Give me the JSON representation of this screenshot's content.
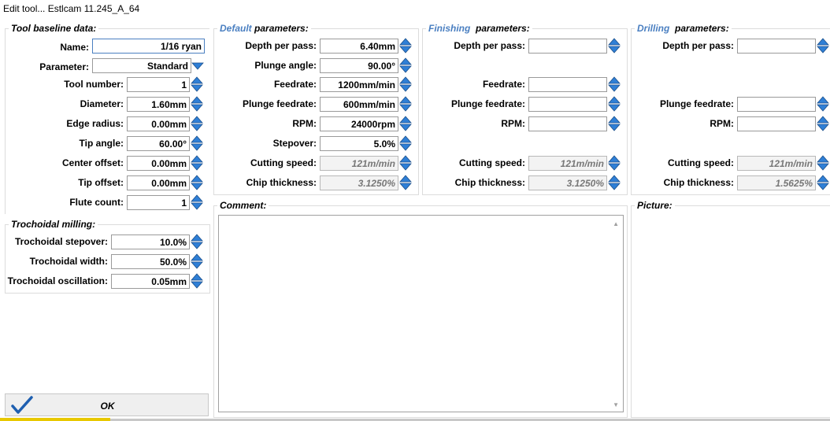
{
  "window": {
    "title": "Edit tool... Estlcam 11.245_A_64"
  },
  "baseline": {
    "title": "Tool baseline data:",
    "name_label": "Name:",
    "name_value": "1/16 ryan",
    "parameter_label": "Parameter:",
    "parameter_value": "Standard",
    "tool_number_label": "Tool number:",
    "tool_number_value": "1",
    "diameter_label": "Diameter:",
    "diameter_value": "1.60mm",
    "edge_radius_label": "Edge radius:",
    "edge_radius_value": "0.00mm",
    "tip_angle_label": "Tip angle:",
    "tip_angle_value": "60.00°",
    "center_offset_label": "Center offset:",
    "center_offset_value": "0.00mm",
    "tip_offset_label": "Tip offset:",
    "tip_offset_value": "0.00mm",
    "flute_count_label": "Flute count:",
    "flute_count_value": "1"
  },
  "trochoidal": {
    "title": "Trochoidal  milling:",
    "stepover_label": "Trochoidal stepover:",
    "stepover_value": "10.0%",
    "width_label": "Trochoidal width:",
    "width_value": "50.0%",
    "oscillation_label": "Trochoidal oscillation:",
    "oscillation_value": "0.05mm"
  },
  "default_params": {
    "title_hl": "Default",
    "title_rest": "parameters:",
    "depth_label": "Depth per pass:",
    "depth_value": "6.40mm",
    "plunge_angle_label": "Plunge angle:",
    "plunge_angle_value": "90.00°",
    "feedrate_label": "Feedrate:",
    "feedrate_value": "1200mm/min",
    "plunge_feedrate_label": "Plunge feedrate:",
    "plunge_feedrate_value": "600mm/min",
    "rpm_label": "RPM:",
    "rpm_value": "24000rpm",
    "stepover_label": "Stepover:",
    "stepover_value": "5.0%",
    "cutting_speed_label": "Cutting speed:",
    "cutting_speed_value": "121m/min",
    "chip_thickness_label": "Chip thickness:",
    "chip_thickness_value": "3.1250%"
  },
  "finishing_params": {
    "title_hl": "Finishing",
    "title_rest": "parameters:",
    "depth_label": "Depth per pass:",
    "depth_value": "",
    "feedrate_label": "Feedrate:",
    "feedrate_value": "",
    "plunge_feedrate_label": "Plunge feedrate:",
    "plunge_feedrate_value": "",
    "rpm_label": "RPM:",
    "rpm_value": "",
    "cutting_speed_label": "Cutting speed:",
    "cutting_speed_value": "121m/min",
    "chip_thickness_label": "Chip thickness:",
    "chip_thickness_value": "3.1250%"
  },
  "drilling_params": {
    "title_hl": "Drilling",
    "title_rest": "parameters:",
    "depth_label": "Depth per pass:",
    "depth_value": "",
    "plunge_feedrate_label": "Plunge feedrate:",
    "plunge_feedrate_value": "",
    "rpm_label": "RPM:",
    "rpm_value": "",
    "cutting_speed_label": "Cutting speed:",
    "cutting_speed_value": "121m/min",
    "chip_thickness_label": "Chip thickness:",
    "chip_thickness_value": "1.5625%"
  },
  "comment": {
    "title": "Comment:",
    "value": ""
  },
  "picture": {
    "title": "Picture:"
  },
  "ok_button": {
    "label": "OK"
  },
  "colors": {
    "accent": "#4a7fc1",
    "spin": "#2f7fd6"
  },
  "icons": {
    "spinner": "up-down-arrows-icon",
    "dropdown": "chevron-down-icon",
    "ok": "checkmark-icon"
  }
}
